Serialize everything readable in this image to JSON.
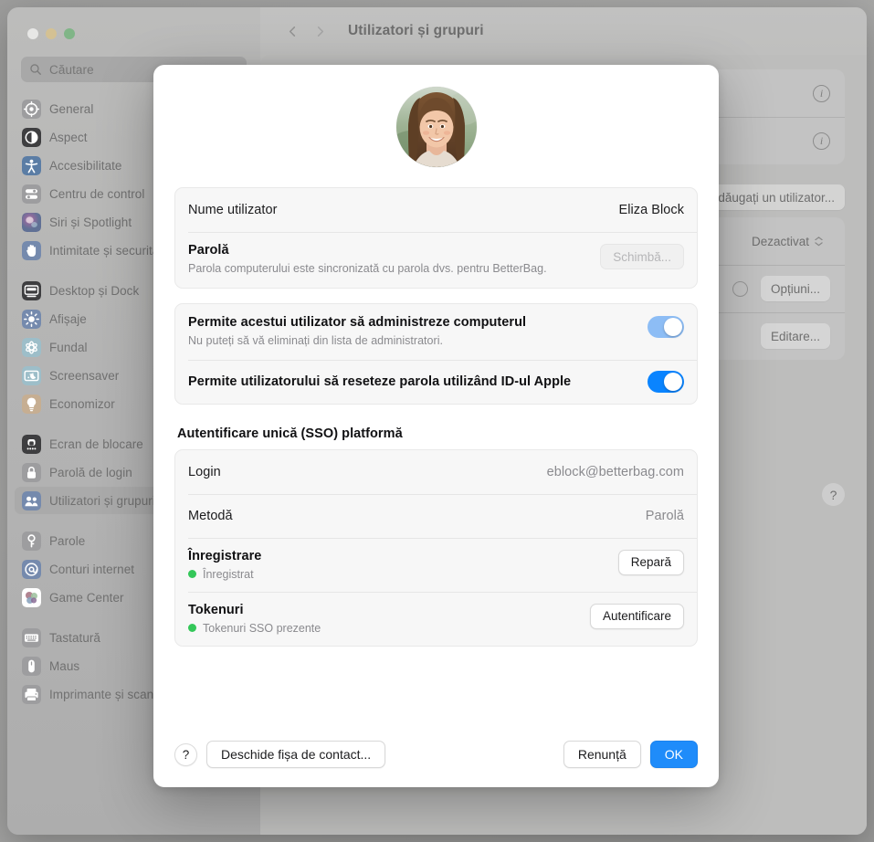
{
  "window": {
    "title": "Utilizatori și grupuri",
    "traffic_lights": [
      "close",
      "minimize",
      "maximize"
    ],
    "search": {
      "placeholder": "Căutare",
      "icon": "search-icon"
    }
  },
  "sidebar": {
    "groups": [
      {
        "items": [
          {
            "label": "General",
            "icon": "gear-icon",
            "color": "#8e8e93",
            "selected": false
          },
          {
            "label": "Aspect",
            "icon": "appearance-icon",
            "color": "#3a3a3c",
            "selected": false
          },
          {
            "label": "Accesibilitate",
            "icon": "accessibility-icon",
            "color": "#0a7cff",
            "selected": false
          },
          {
            "label": "Centru de control",
            "icon": "control-center-icon",
            "color": "#8e8e93",
            "selected": false
          },
          {
            "label": "Siri și Spotlight",
            "icon": "siri-icon",
            "color": "#c24fa0",
            "selected": false
          },
          {
            "label": "Intimitate și securitate",
            "icon": "privacy-hand-icon",
            "color": "#4a8cf7",
            "selected": false
          }
        ]
      },
      {
        "items": [
          {
            "label": "Desktop și Dock",
            "icon": "desktop-dock-icon",
            "color": "#3a3a3c",
            "selected": false
          },
          {
            "label": "Afișaje",
            "icon": "displays-icon",
            "color": "#4a8cf7",
            "selected": false
          },
          {
            "label": "Fundal",
            "icon": "wallpaper-icon",
            "color": "#5ac8e8",
            "selected": false
          },
          {
            "label": "Screensaver",
            "icon": "screensaver-icon",
            "color": "#5ac8e8",
            "selected": false
          },
          {
            "label": "Economizor",
            "icon": "energy-saver-icon",
            "color": "#e8a34a",
            "selected": false
          }
        ]
      },
      {
        "items": [
          {
            "label": "Ecran de blocare",
            "icon": "lock-screen-icon",
            "color": "#3a3a3c",
            "selected": false
          },
          {
            "label": "Parolă de login",
            "icon": "login-password-icon",
            "color": "#8e8e93",
            "selected": false
          },
          {
            "label": "Utilizatori și grupuri",
            "icon": "users-groups-icon",
            "color": "#4a8cf7",
            "selected": true
          }
        ]
      },
      {
        "items": [
          {
            "label": "Parole",
            "icon": "passwords-key-icon",
            "color": "#8e8e93",
            "selected": false
          },
          {
            "label": "Conturi internet",
            "icon": "internet-accounts-icon",
            "color": "#4a8cf7",
            "selected": false
          },
          {
            "label": "Game Center",
            "icon": "game-center-icon",
            "color": "#ffffff",
            "selected": false
          }
        ]
      },
      {
        "items": [
          {
            "label": "Tastatură",
            "icon": "keyboard-icon",
            "color": "#8e8e93",
            "selected": false
          },
          {
            "label": "Maus",
            "icon": "mouse-icon",
            "color": "#8e8e93",
            "selected": false
          },
          {
            "label": "Imprimante și scanere",
            "icon": "printers-scanners-icon",
            "color": "#8e8e93",
            "selected": false
          }
        ]
      }
    ]
  },
  "background_pane": {
    "back_icon": "chevron-left-icon",
    "forward_icon": "chevron-right-icon",
    "rows": [
      {
        "type": "info",
        "icon": "info-circle-icon"
      },
      {
        "type": "info",
        "icon": "info-circle-icon"
      }
    ],
    "add_user_button": "Adăugați un utilizator...",
    "guest_value": "Dezactivat",
    "options_button": "Opțiuni...",
    "edit_button": "Editare...",
    "help_button": "?"
  },
  "sheet": {
    "avatar": {
      "name": "user-avatar",
      "alt": "Eliza Block"
    },
    "account": {
      "username_label": "Nume utilizator",
      "username_value": "Eliza Block",
      "password_label": "Parolă",
      "password_button": "Schimbă...",
      "password_button_disabled": true,
      "password_description": "Parola computerului este sincronizată cu parola dvs. pentru BetterBag."
    },
    "permissions": [
      {
        "label": "Permite acestui utilizator să administreze computerul",
        "sub": "Nu puteți să vă eliminați din lista de administratori.",
        "toggle_on": true,
        "toggle_disabled": true,
        "toggle_color": "#8dbdf5"
      },
      {
        "label": "Permite utilizatorului să reseteze parola utilizând ID-ul Apple",
        "sub": "",
        "toggle_on": true,
        "toggle_disabled": false,
        "toggle_color": "#0a84ff"
      }
    ],
    "sso": {
      "heading": "Autentificare unică (SSO) platformă",
      "rows": [
        {
          "label": "Login",
          "value": "eblock@betterbag.com",
          "value_style": "grey"
        },
        {
          "label": "Metodă",
          "value": "Parolă",
          "value_style": "grey"
        },
        {
          "label": "Înregistrare",
          "status_text": "Înregistrat",
          "status_color": "#34c759",
          "button": "Repară"
        },
        {
          "label": "Tokenuri",
          "status_text": "Tokenuri SSO prezente",
          "status_color": "#34c759",
          "button": "Autentificare"
        }
      ]
    },
    "footer": {
      "help_label": "?",
      "contact_card_button": "Deschide fișa de contact...",
      "cancel_button": "Renunță",
      "ok_button": "OK",
      "ok_accent": "#1f8cfa"
    }
  }
}
